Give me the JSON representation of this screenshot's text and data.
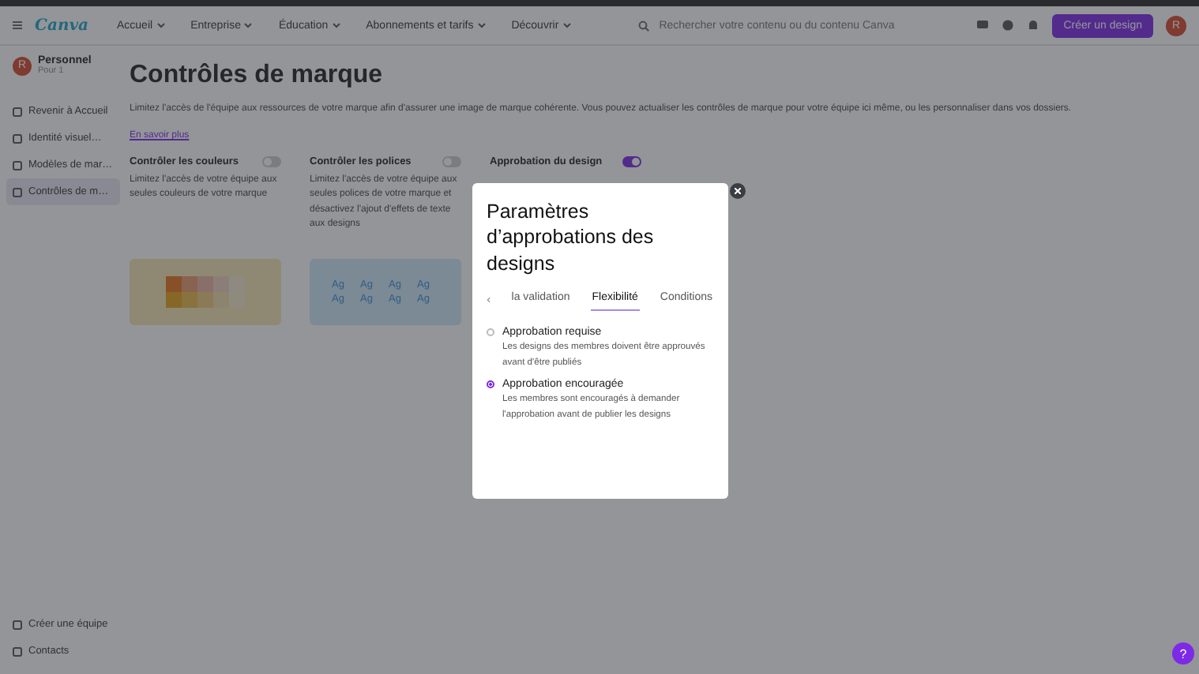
{
  "nav": {
    "logo": "Canva",
    "menu": [
      {
        "label": "Accueil"
      },
      {
        "label": "Entreprise"
      },
      {
        "label": "Éducation"
      },
      {
        "label": "Abonnements et tarifs"
      },
      {
        "label": "Découvrir"
      }
    ],
    "search": {
      "placeholder": "Rechercher votre contenu ou du contenu Canva"
    },
    "create_button": "Créer un design",
    "avatar": "R"
  },
  "sidebar": {
    "account": {
      "avatar": "R",
      "name": "Personnel",
      "sub": "Pour 1"
    },
    "items": [
      {
        "label": "Revenir à Accueil",
        "selected": false
      },
      {
        "label": "Identité visuel…",
        "selected": false
      },
      {
        "label": "Modèles de mar…",
        "selected": false
      },
      {
        "label": "Contrôles de m…",
        "selected": true
      }
    ],
    "bottom": [
      {
        "label": "Créer une équipe"
      },
      {
        "label": "Contacts"
      }
    ]
  },
  "main": {
    "title": "Contrôles de marque",
    "description": "Limitez l'accès de l'équipe aux ressources de votre marque afin d'assurer une image de marque cohérente. Vous pouvez actualiser les contrôles de marque pour votre équipe ici même, ou les personnaliser dans vos dossiers.",
    "link": "En savoir plus",
    "cards": [
      {
        "kind": "colors",
        "title": "Contrôler les couleurs",
        "on": false,
        "text": "Limitez l'accès de votre équipe aux seules couleurs de votre marque"
      },
      {
        "kind": "fonts",
        "title": "Contrôler les polices",
        "on": false,
        "text": "Limitez l'accès de votre équipe aux seules polices de votre marque et désactivez l'ajout d'effets de texte aux designs",
        "samples": [
          "Ag",
          "Ag",
          "Ag",
          "Ag",
          "Ag",
          "Ag",
          "Ag",
          "Ag"
        ]
      },
      {
        "kind": "approval",
        "title": "Approbation du design",
        "on": true
      }
    ]
  },
  "dialog": {
    "title": "Paramètres d’approbations des designs",
    "tabs": [
      {
        "label": "la validation",
        "selected": false
      },
      {
        "label": "Flexibilité",
        "selected": true
      },
      {
        "label": "Conditions",
        "selected": false
      }
    ],
    "options": [
      {
        "title": "Approbation requise",
        "text": "Les designs des membres doivent être approuvés avant d'être publiés",
        "selected": false
      },
      {
        "title": "Approbation encouragée",
        "text": "Les membres sont encouragés à demander l'approbation avant de publier les designs",
        "selected": true
      }
    ]
  },
  "help_button": "?"
}
